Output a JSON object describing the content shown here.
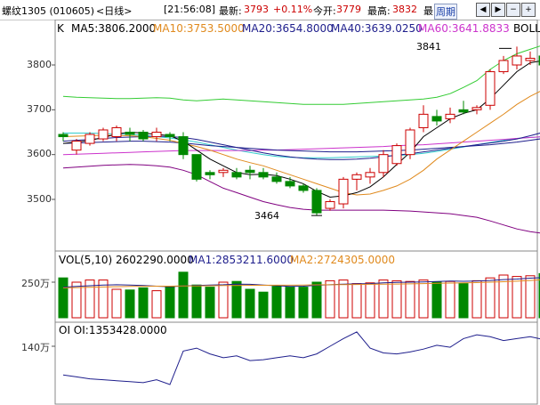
{
  "header": {
    "instrument": "螺纹1305 (010605)",
    "period": "<日线>",
    "time": "[21:56:08]",
    "last_label": "最新:",
    "last_value": "3793",
    "change": "+0.11%",
    "open_label": "今开:",
    "open_value": "3779",
    "high_label": "最高:",
    "high_value": "3832",
    "extra_label": "最",
    "period_button": "周期"
  },
  "price_panel": {
    "left_mark": "K",
    "ma5": "MA5:3806.2000",
    "ma10": "MA10:3753.5000",
    "ma20": "MA20:3654.8000",
    "ma40": "MA40:3639.0250",
    "ma60": "MA60:3641.8833",
    "boll": "BOLL",
    "y_ticks": [
      "3800",
      "3700",
      "3600",
      "3500"
    ],
    "annotation_high": "3841",
    "annotation_low": "3464",
    "colors": {
      "ma5": "#000000",
      "ma10": "#e08a1e",
      "ma20": "#1e1e8c",
      "ma40": "#1e1e8c",
      "ma60": "#cc33cc",
      "boll_up": "#33cc33",
      "boll_mid": "#33cccc",
      "boll_low": "#800080",
      "up": "#cc0000",
      "down": "#008800"
    }
  },
  "volume_panel": {
    "title": "VOL(5,10) 2602290.0000",
    "ma1": "MA1:2853211.6000",
    "ma2": "MA2:2724305.0000",
    "y_tick": "250万"
  },
  "oi_panel": {
    "title": "OI OI:1353428.0000",
    "y_tick": "140万"
  },
  "chart_data": {
    "type": "candlestick",
    "ohlc": [
      [
        3645,
        3650,
        3630,
        3640
      ],
      [
        3610,
        3635,
        3600,
        3630
      ],
      [
        3625,
        3650,
        3620,
        3645
      ],
      [
        3635,
        3660,
        3630,
        3655
      ],
      [
        3640,
        3665,
        3630,
        3660
      ],
      [
        3650,
        3660,
        3630,
        3645
      ],
      [
        3650,
        3655,
        3630,
        3635
      ],
      [
        3640,
        3660,
        3630,
        3650
      ],
      [
        3645,
        3650,
        3630,
        3640
      ],
      [
        3640,
        3650,
        3590,
        3600
      ],
      [
        3600,
        3600,
        3540,
        3545
      ],
      [
        3560,
        3565,
        3545,
        3555
      ],
      [
        3560,
        3570,
        3550,
        3565
      ],
      [
        3560,
        3570,
        3545,
        3550
      ],
      [
        3565,
        3575,
        3545,
        3560
      ],
      [
        3560,
        3570,
        3545,
        3550
      ],
      [
        3550,
        3560,
        3535,
        3540
      ],
      [
        3540,
        3550,
        3525,
        3530
      ],
      [
        3530,
        3535,
        3515,
        3520
      ],
      [
        3520,
        3525,
        3464,
        3470
      ],
      [
        3480,
        3500,
        3475,
        3495
      ],
      [
        3490,
        3550,
        3480,
        3545
      ],
      [
        3545,
        3560,
        3520,
        3555
      ],
      [
        3550,
        3570,
        3535,
        3560
      ],
      [
        3560,
        3610,
        3550,
        3600
      ],
      [
        3580,
        3625,
        3575,
        3620
      ],
      [
        3600,
        3660,
        3590,
        3655
      ],
      [
        3660,
        3710,
        3650,
        3690
      ],
      [
        3685,
        3700,
        3665,
        3675
      ],
      [
        3680,
        3705,
        3670,
        3690
      ],
      [
        3700,
        3720,
        3690,
        3695
      ],
      [
        3700,
        3710,
        3690,
        3705
      ],
      [
        3710,
        3790,
        3700,
        3785
      ],
      [
        3785,
        3820,
        3780,
        3810
      ],
      [
        3800,
        3841,
        3790,
        3820
      ],
      [
        3810,
        3830,
        3800,
        3815
      ],
      [
        3820,
        3830,
        3790,
        3800
      ],
      [
        3780,
        3832,
        3770,
        3793
      ]
    ],
    "ma5": [
      3625,
      3628,
      3632,
      3638,
      3646,
      3650,
      3648,
      3645,
      3642,
      3630,
      3610,
      3590,
      3575,
      3560,
      3555,
      3556,
      3553,
      3545,
      3535,
      3518,
      3505,
      3508,
      3515,
      3528,
      3550,
      3578,
      3605,
      3640,
      3660,
      3680,
      3692,
      3700,
      3725,
      3755,
      3785,
      3805,
      3810,
      3806
    ],
    "ma10": [
      3640,
      3641,
      3642,
      3643,
      3643,
      3642,
      3640,
      3636,
      3632,
      3625,
      3618,
      3610,
      3600,
      3590,
      3582,
      3575,
      3565,
      3555,
      3545,
      3535,
      3525,
      3515,
      3510,
      3512,
      3520,
      3530,
      3545,
      3565,
      3590,
      3610,
      3630,
      3650,
      3670,
      3690,
      3712,
      3730,
      3745,
      3753
    ],
    "ma20": [
      3630,
      3632,
      3634,
      3636,
      3638,
      3639,
      3640,
      3641,
      3640,
      3638,
      3634,
      3628,
      3622,
      3616,
      3610,
      3604,
      3599,
      3595,
      3592,
      3590,
      3589,
      3589,
      3590,
      3592,
      3595,
      3599,
      3602,
      3606,
      3610,
      3614,
      3618,
      3622,
      3626,
      3630,
      3635,
      3642,
      3650,
      3655
    ],
    "ma40": [
      3625,
      3626,
      3627,
      3628,
      3629,
      3630,
      3630,
      3629,
      3628,
      3626,
      3623,
      3620,
      3618,
      3616,
      3614,
      3612,
      3610,
      3609,
      3608,
      3607,
      3606,
      3606,
      3606,
      3607,
      3608,
      3609,
      3610,
      3612,
      3614,
      3616,
      3618,
      3620,
      3622,
      3625,
      3628,
      3632,
      3636,
      3639
    ],
    "ma60": [
      3600,
      3601,
      3602,
      3603,
      3604,
      3605,
      3606,
      3607,
      3608,
      3609,
      3609,
      3609,
      3609,
      3609,
      3609,
      3610,
      3610,
      3611,
      3612,
      3613,
      3614,
      3615,
      3616,
      3617,
      3618,
      3620,
      3621,
      3622,
      3624,
      3626,
      3628,
      3630,
      3632,
      3634,
      3636,
      3638,
      3640,
      3641
    ],
    "boll_up": [
      3730,
      3728,
      3727,
      3726,
      3725,
      3725,
      3726,
      3727,
      3726,
      3722,
      3720,
      3722,
      3724,
      3722,
      3720,
      3718,
      3716,
      3714,
      3712,
      3712,
      3712,
      3712,
      3714,
      3716,
      3718,
      3720,
      3722,
      3724,
      3728,
      3736,
      3750,
      3765,
      3790,
      3810,
      3825,
      3835,
      3845,
      3852
    ],
    "boll_mid": [
      3648,
      3648,
      3648,
      3647,
      3646,
      3645,
      3643,
      3640,
      3637,
      3633,
      3628,
      3622,
      3616,
      3610,
      3605,
      3600,
      3596,
      3594,
      3593,
      3593,
      3593,
      3594,
      3595,
      3596,
      3597,
      3598,
      3600,
      3603,
      3607,
      3612,
      3617,
      3622,
      3627,
      3632,
      3636,
      3638,
      3640,
      3641
    ],
    "boll_low": [
      3570,
      3572,
      3574,
      3576,
      3577,
      3578,
      3577,
      3575,
      3572,
      3565,
      3555,
      3540,
      3525,
      3515,
      3505,
      3495,
      3488,
      3482,
      3478,
      3476,
      3476,
      3476,
      3476,
      3476,
      3476,
      3475,
      3474,
      3472,
      3470,
      3468,
      3464,
      3460,
      3452,
      3443,
      3434,
      3428,
      3424,
      3422
    ],
    "volume": [
      280,
      250,
      265,
      265,
      200,
      195,
      210,
      190,
      220,
      320,
      230,
      215,
      250,
      255,
      200,
      180,
      220,
      215,
      215,
      250,
      260,
      265,
      240,
      245,
      265,
      260,
      255,
      265,
      250,
      255,
      240,
      260,
      280,
      300,
      290,
      295,
      310,
      305
    ],
    "vol_ma1": [
      215,
      220,
      225,
      230,
      232,
      230,
      226,
      222,
      218,
      224,
      226,
      230,
      232,
      236,
      235,
      230,
      225,
      220,
      222,
      228,
      232,
      236,
      238,
      240,
      245,
      248,
      250,
      252,
      255,
      258,
      256,
      258,
      262,
      268,
      272,
      278,
      282,
      285
    ],
    "vol_ma2": [
      210,
      212,
      214,
      216,
      218,
      220,
      221,
      222,
      222,
      223,
      224,
      225,
      226,
      227,
      228,
      228,
      229,
      229,
      230,
      231,
      232,
      233,
      234,
      235,
      236,
      237,
      238,
      240,
      242,
      244,
      245,
      247,
      250,
      253,
      257,
      262,
      268,
      272
    ],
    "oi": [
      110,
      108,
      106,
      105,
      104,
      103,
      102,
      105,
      100,
      135,
      138,
      132,
      128,
      130,
      125,
      126,
      128,
      130,
      128,
      132,
      140,
      148,
      155,
      138,
      133,
      132,
      134,
      137,
      141,
      139,
      148,
      152,
      150,
      146,
      148,
      150,
      147,
      140
    ]
  }
}
